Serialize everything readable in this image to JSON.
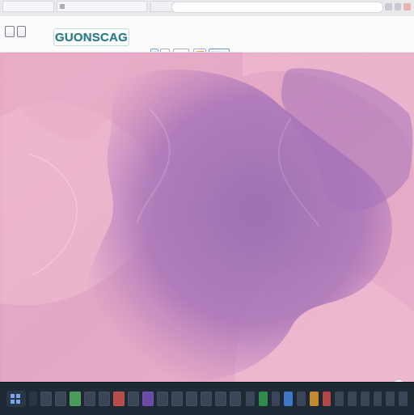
{
  "browser": {
    "tabs": [
      {
        "label": ""
      },
      {
        "label": ""
      },
      {
        "label": ""
      }
    ],
    "address_bar": {
      "value": ""
    }
  },
  "app": {
    "brand_text": "GUONSCAG"
  },
  "icons": {
    "logo": "logo-icon",
    "back": "chevron-left-icon",
    "forward": "chevron-right-icon",
    "windows": "windows-icon"
  },
  "taskbar": {
    "apps_count": 14,
    "tray_count": 13
  }
}
